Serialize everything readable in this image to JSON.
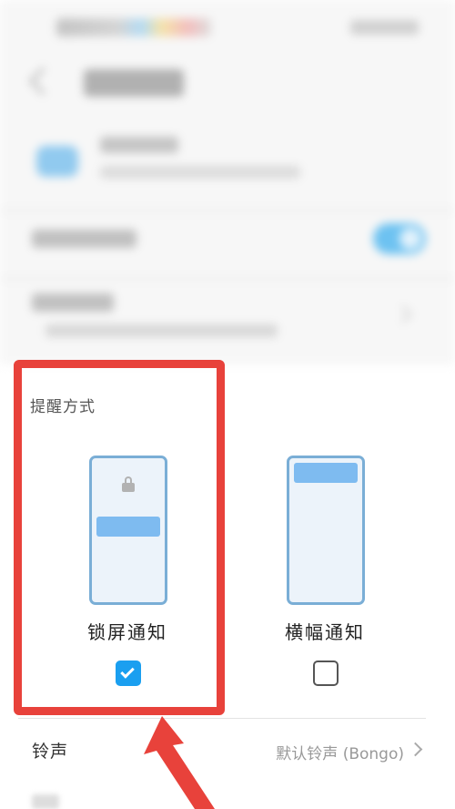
{
  "reminder": {
    "section_title": "提醒方式",
    "options": [
      {
        "label": "锁屏通知",
        "checked": true
      },
      {
        "label": "横幅通知",
        "checked": false
      }
    ]
  },
  "ringtone": {
    "label": "铃声",
    "value": "默认铃声 (Bongo)"
  },
  "colors": {
    "accent": "#1a9ff0",
    "highlight": "#e8423b",
    "illustration": "#7ebbf0"
  },
  "icons": [
    "lock-icon",
    "check-icon",
    "chevron-right-icon",
    "back-arrow-icon",
    "toggle-switch"
  ]
}
